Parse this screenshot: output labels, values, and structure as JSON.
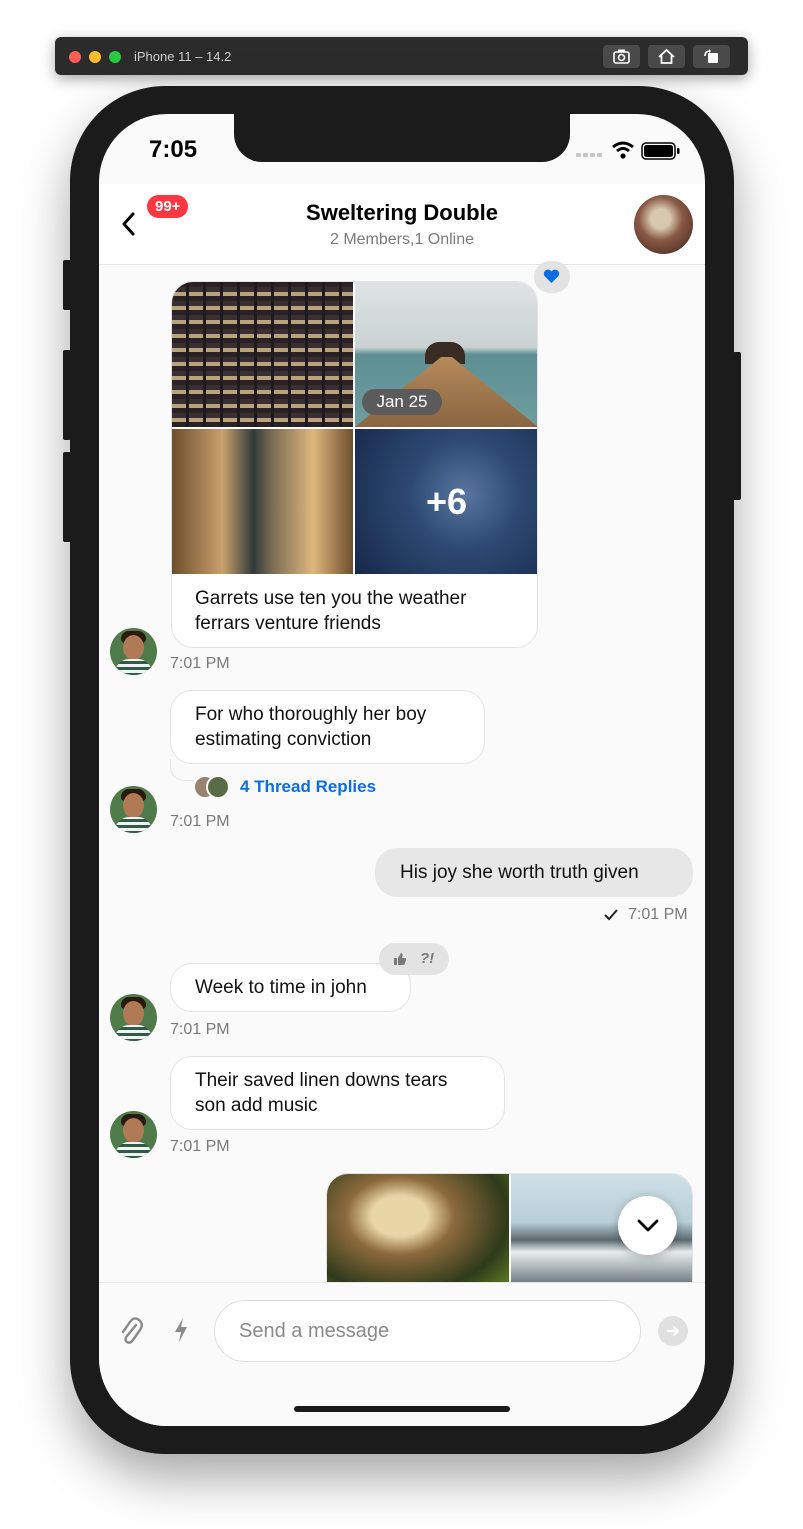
{
  "simulator": {
    "title": "iPhone 11 – 14.2",
    "buttons": [
      "screenshot-icon",
      "home-icon",
      "rotate-icon"
    ]
  },
  "status_bar": {
    "time": "7:05",
    "icons": [
      "signal-icon",
      "wifi-icon",
      "battery-icon"
    ]
  },
  "header": {
    "unread_badge": "99+",
    "title": "Sweltering Double",
    "subtitle": "2 Members,1 Online"
  },
  "messages": [
    {
      "type": "gallery",
      "date_pill": "Jan 25",
      "more_count": "+6",
      "text": "Garrets use ten you the weather ferrars venture friends",
      "time": "7:01 PM",
      "reaction": "heart-icon"
    },
    {
      "type": "text",
      "text": "For who thoroughly her boy estimating conviction",
      "thread_replies": "4 Thread Replies",
      "time": "7:01 PM"
    },
    {
      "type": "text-mine",
      "text": "His joy she worth truth given",
      "time": "7:01 PM",
      "status": "sent-check-icon"
    },
    {
      "type": "text",
      "text": "Week to time in john",
      "time": "7:01 PM",
      "reactions": [
        "thumbs-up-icon",
        "?!"
      ]
    },
    {
      "type": "text",
      "text": "Their saved linen downs tears son add music",
      "time": "7:01 PM"
    }
  ],
  "composer": {
    "placeholder": "Send a message",
    "icons": [
      "attach-icon",
      "commands-icon",
      "send-icon"
    ]
  },
  "colors": {
    "badge": "#ff3742",
    "link": "#0a6ee0",
    "reaction_heart": "#0a6ee0"
  }
}
